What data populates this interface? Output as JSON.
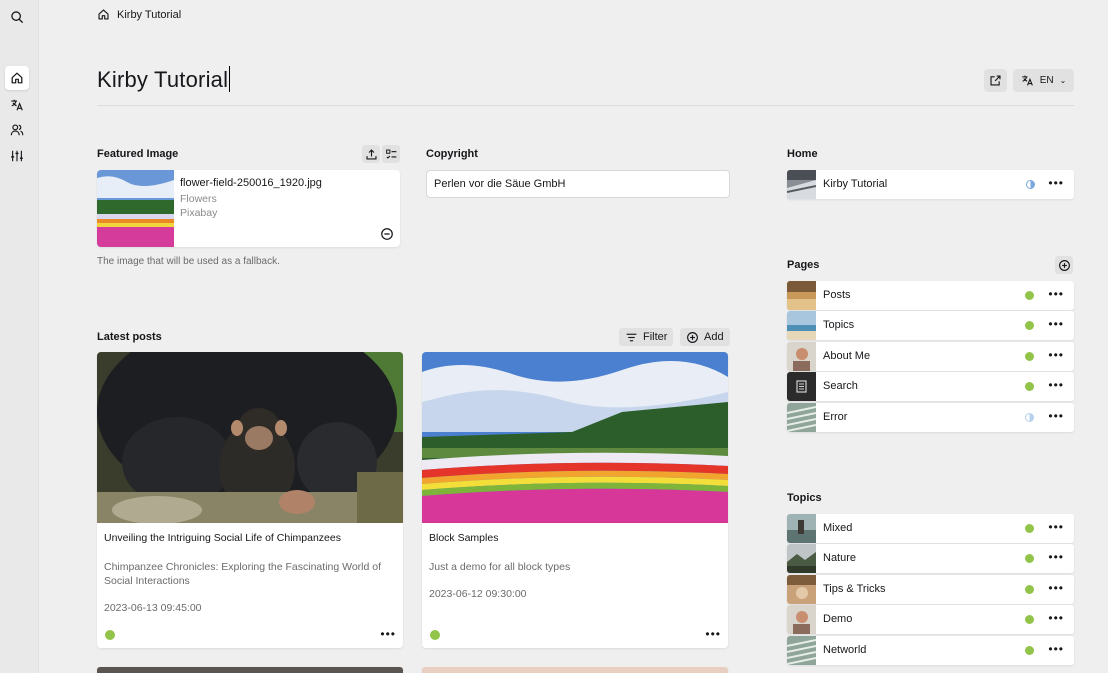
{
  "menu": {
    "items": [
      {
        "icon": "search-icon"
      },
      {
        "icon": "home-icon",
        "active": true
      },
      {
        "icon": "translate-icon"
      },
      {
        "icon": "users-icon"
      },
      {
        "icon": "settings-sliders-icon"
      }
    ]
  },
  "breadcrumb": {
    "label": "Kirby Tutorial"
  },
  "header": {
    "title": "Kirby Tutorial",
    "language": "EN"
  },
  "featured_image": {
    "label": "Featured Image",
    "filename": "flower-field-250016_1920.jpg",
    "info": "Flowers",
    "credit": "Pixabay",
    "help": "The image that will be used as a fallback."
  },
  "copyright": {
    "label": "Copyright",
    "value": "Perlen vor die Säue GmbH"
  },
  "home_section": {
    "label": "Home",
    "item": {
      "title": "Kirby Tutorial",
      "status": "unlisted"
    }
  },
  "pages_section": {
    "label": "Pages",
    "items": [
      {
        "title": "Posts",
        "status": "listed"
      },
      {
        "title": "Topics",
        "status": "listed"
      },
      {
        "title": "About Me",
        "status": "listed"
      },
      {
        "title": "Search",
        "status": "listed"
      },
      {
        "title": "Error",
        "status": "unlisted"
      }
    ]
  },
  "latest_posts": {
    "label": "Latest posts",
    "filter_label": "Filter",
    "add_label": "Add",
    "posts": [
      {
        "title": "Unveiling the Intriguing Social Life of Chimpanzees",
        "text_line1": "Chimpanzee Chronicles: Exploring the Fascinating World of",
        "text_line2": "Social Interactions",
        "date": "2023-06-13 09:45:00",
        "status": "listed"
      },
      {
        "title": "Block Samples",
        "text_line1": "Just a demo for all block types",
        "text_line2": "",
        "date": "2023-06-12 09:30:00",
        "status": "listed"
      }
    ]
  },
  "topics_section": {
    "label": "Topics",
    "items": [
      {
        "title": "Mixed",
        "status": "listed"
      },
      {
        "title": "Nature",
        "status": "listed"
      },
      {
        "title": "Tips & Tricks",
        "status": "listed"
      },
      {
        "title": "Demo",
        "status": "listed"
      },
      {
        "title": "Networld",
        "status": "listed"
      }
    ]
  },
  "colors": {
    "listed": "#91c449",
    "unlisted": "#7aa7dc",
    "background": "#efefef"
  }
}
